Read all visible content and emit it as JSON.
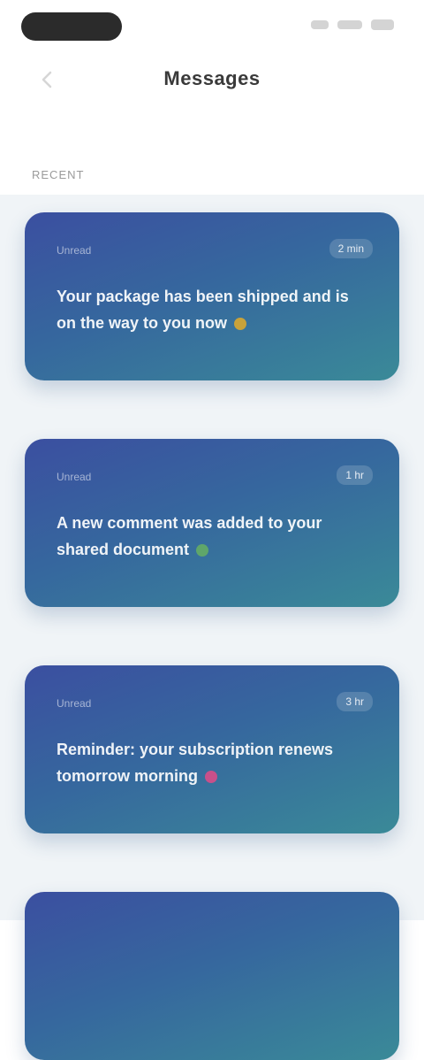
{
  "header": {
    "title": "Messages"
  },
  "section": {
    "label": "Recent"
  },
  "cards": [
    {
      "meta": "Unread",
      "badge": "2 min",
      "text": "Your package has been shipped and is on the way to you now",
      "dot_color": "#c8a23a"
    },
    {
      "meta": "Unread",
      "badge": "1 hr",
      "text": "A new comment was added to your shared document",
      "dot_color": "#5fa66a"
    },
    {
      "meta": "Unread",
      "badge": "3 hr",
      "text": "Reminder: your subscription renews tomorrow morning",
      "dot_color": "#c8508a"
    },
    {
      "meta": "",
      "badge": "",
      "text": ""
    }
  ]
}
